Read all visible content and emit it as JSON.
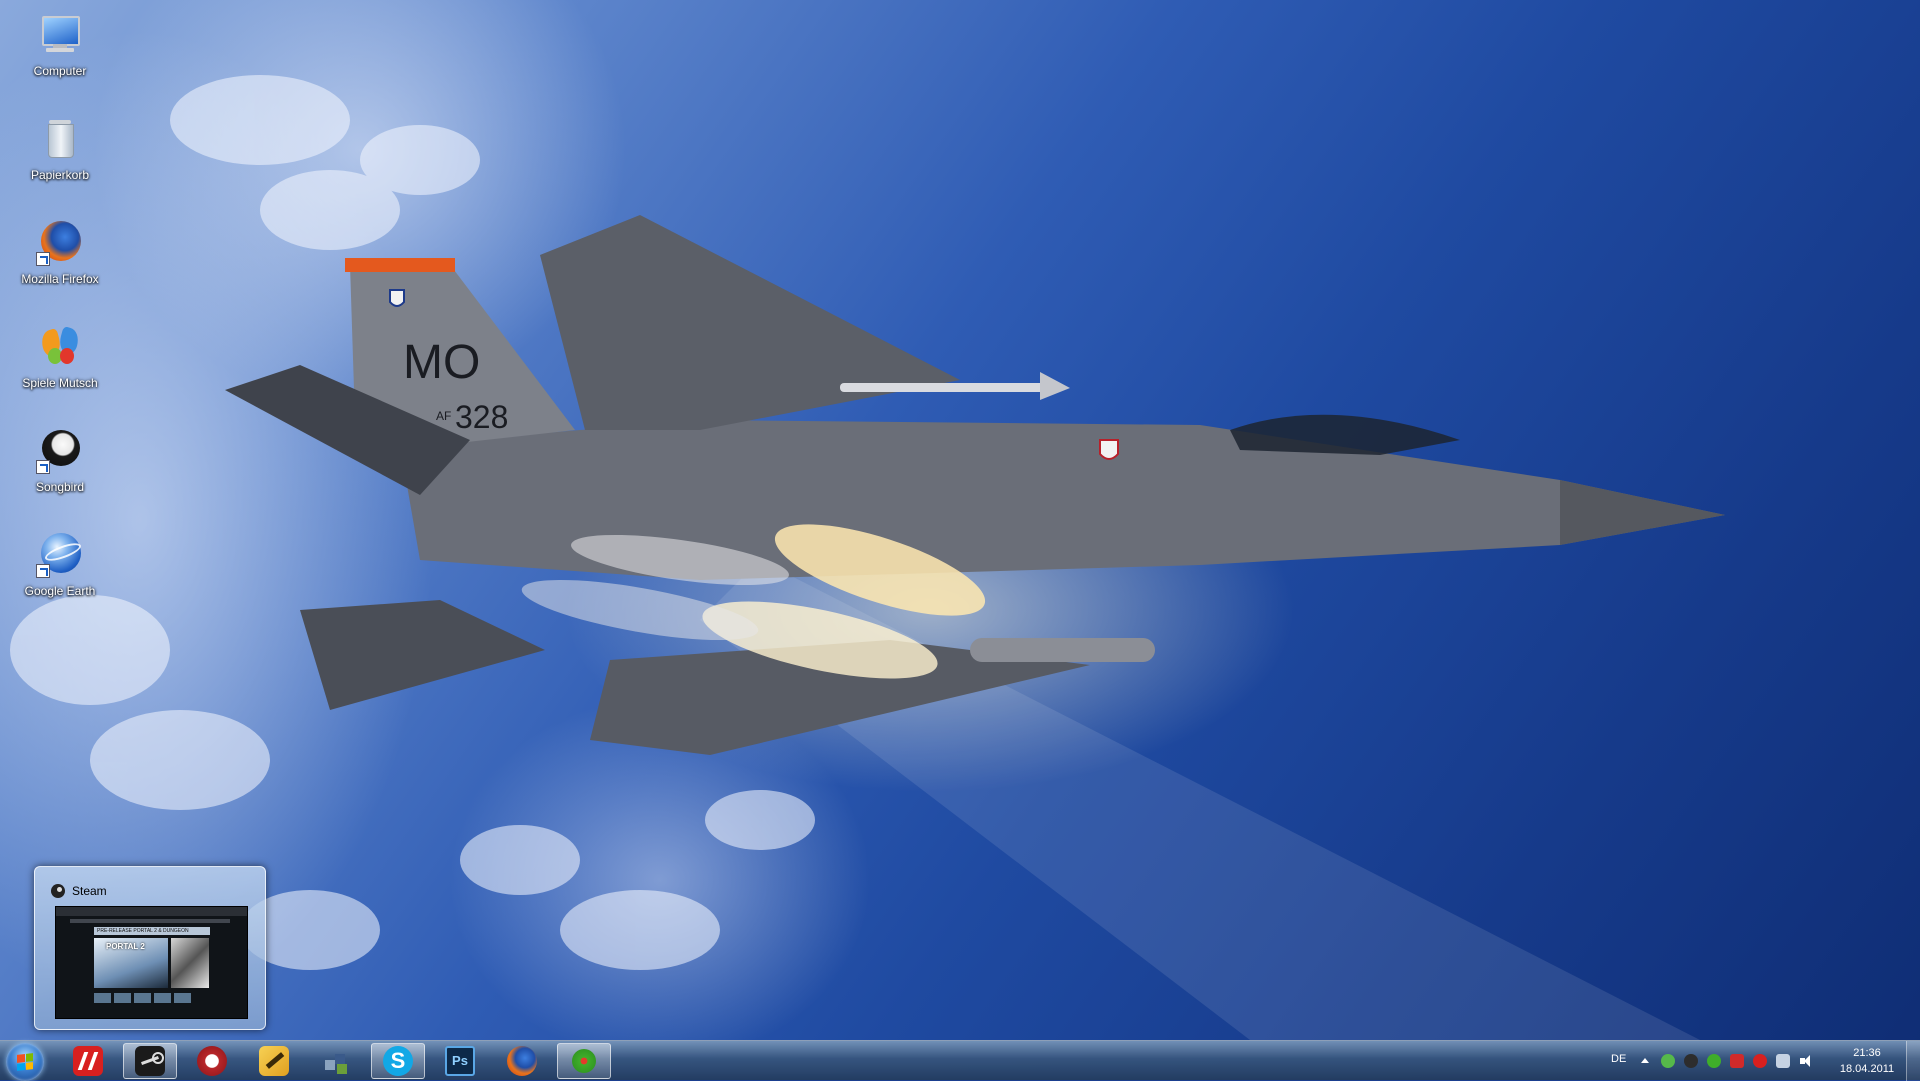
{
  "desktop": {
    "icons": [
      {
        "label": "Computer",
        "icon": "computer-icon"
      },
      {
        "label": "Papierkorb",
        "icon": "recycle-bin-icon"
      },
      {
        "label": "Mozilla Firefox",
        "icon": "firefox-icon"
      },
      {
        "label": "Spiele Mutsch",
        "icon": "msn-butterfly-icon"
      },
      {
        "label": "Songbird",
        "icon": "songbird-icon"
      },
      {
        "label": "Google Earth",
        "icon": "google-earth-icon"
      }
    ],
    "wallpaper": {
      "tail_code": "MO",
      "tail_number": "328",
      "tail_prefix": "AF"
    }
  },
  "preview": {
    "title": "Steam",
    "thumb_banner": "PRE-RELEASE PORTAL 2 & DUNGEON",
    "thumb_hero": "PORTAL 2"
  },
  "taskbar": {
    "pinned": [
      {
        "name": "avira-icon",
        "color": "#d8201f"
      },
      {
        "name": "steam-icon",
        "color": "#1b1b1b",
        "active": true
      },
      {
        "name": "app-red-circle-icon",
        "color": "#b7262a"
      },
      {
        "name": "winamp-icon",
        "color": "#e0a020"
      },
      {
        "name": "windows-tiles-icon",
        "color": "#6b9f3a"
      },
      {
        "name": "skype-icon",
        "color": "#12a8e6"
      },
      {
        "name": "photoshop-icon",
        "color": "#0d2a4a"
      },
      {
        "name": "firefox-icon",
        "color": "#e46a1b"
      },
      {
        "name": "icq-icon",
        "color": "#3fae2a",
        "active": true
      }
    ],
    "language": "DE",
    "clock": {
      "time": "21:36",
      "date": "18.04.2011"
    }
  },
  "colors": {
    "sky_dark": "#0f2d74",
    "sky_light": "#8aa9dc",
    "taskbar": "#37557d"
  }
}
